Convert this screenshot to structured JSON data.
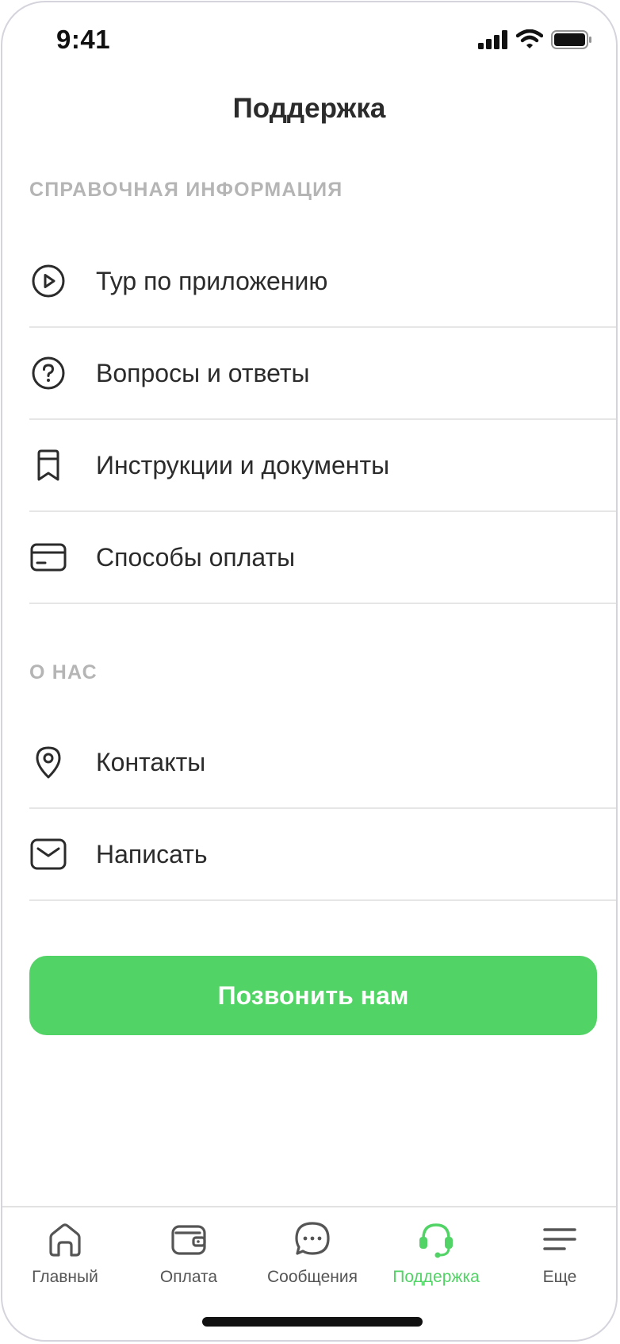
{
  "status_bar": {
    "time": "9:41"
  },
  "header": {
    "title": "Поддержка"
  },
  "sections": [
    {
      "title": "СПРАВОЧНАЯ ИНФОРМАЦИЯ",
      "items": [
        {
          "label": "Тур по приложению",
          "icon": "play-circle-icon"
        },
        {
          "label": "Вопросы и ответы",
          "icon": "question-circle-icon"
        },
        {
          "label": "Инструкции и документы",
          "icon": "bookmark-icon"
        },
        {
          "label": "Способы оплаты",
          "icon": "card-icon"
        }
      ]
    },
    {
      "title": "О НАС",
      "items": [
        {
          "label": "Контакты",
          "icon": "location-pin-icon"
        },
        {
          "label": "Написать",
          "icon": "mail-icon"
        }
      ]
    }
  ],
  "call_button": {
    "label": "Позвонить нам"
  },
  "tab_bar": {
    "items": [
      {
        "label": "Главный",
        "icon": "home-icon"
      },
      {
        "label": "Оплата",
        "icon": "wallet-icon"
      },
      {
        "label": "Сообщения",
        "icon": "chat-icon"
      },
      {
        "label": "Поддержка",
        "icon": "headset-icon"
      },
      {
        "label": "Еще",
        "icon": "menu-icon"
      }
    ],
    "active_index": 3
  },
  "colors": {
    "accent": "#52d365",
    "text": "#2b2b2b",
    "section_title": "#b5b5b5",
    "divider": "#e6e6e6"
  }
}
